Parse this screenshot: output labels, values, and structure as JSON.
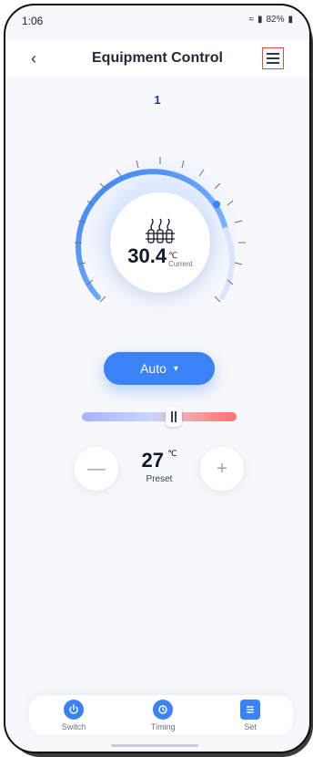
{
  "status": {
    "time": "1:06",
    "battery": "82%"
  },
  "header": {
    "back_icon": "chevron-left-icon",
    "title": "Equipment Control",
    "menu_icon": "menu-icon"
  },
  "device": {
    "number": "1"
  },
  "thermostat": {
    "current_value": "30.4",
    "current_unit": "℃",
    "current_label": "Current",
    "heater_icon": "heater-icon",
    "arc_color": "#3b82f6"
  },
  "mode": {
    "label": "Auto",
    "caret_icon": "caret-down-icon"
  },
  "preset": {
    "value": "27",
    "unit": "℃",
    "label": "Preset"
  },
  "bottom_nav": [
    {
      "label": "Switch",
      "icon": "power-icon"
    },
    {
      "label": "Timing",
      "icon": "alarm-clock-icon"
    },
    {
      "label": "Set",
      "icon": "sliders-icon"
    }
  ]
}
